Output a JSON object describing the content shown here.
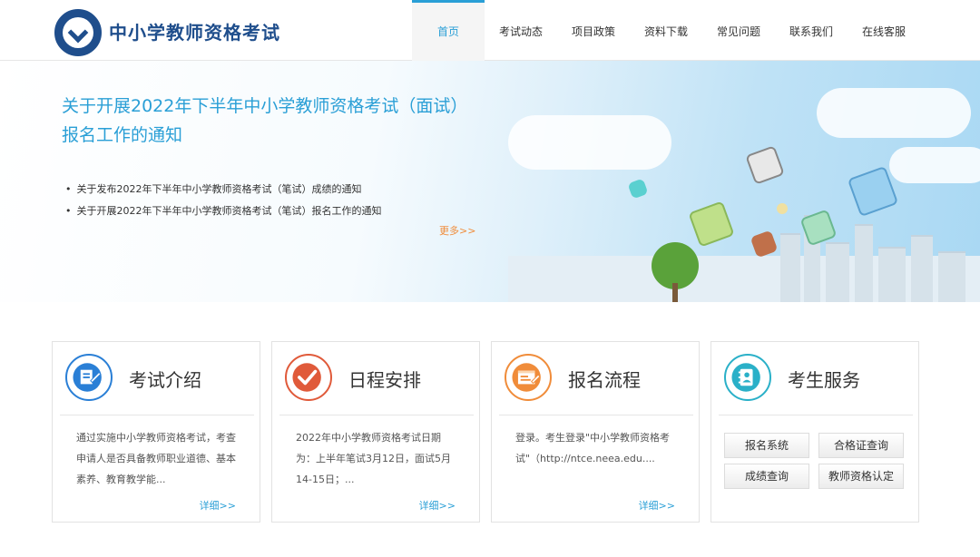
{
  "header": {
    "site_title": "中小学教师资格考试",
    "logo_icon": "book-logo-icon",
    "nav": [
      "首页",
      "考试动态",
      "项目政策",
      "资料下载",
      "常见问题",
      "联系我们",
      "在线客服"
    ],
    "active_nav": "首页"
  },
  "banner": {
    "title": "关于开展2022年下半年中小学教师资格考试（面试）报名工作的通知",
    "list": [
      "关于发布2022年下半年中小学教师资格考试（笔试）成绩的通知",
      "关于开展2022年下半年中小学教师资格考试（笔试）报名工作的通知"
    ],
    "more": "更多>>"
  },
  "cards": [
    {
      "title": "考试介绍",
      "icon": "document-edit-icon",
      "color": "#2a7fd6",
      "desc": "通过实施中小学教师资格考试，考查申请人是否具备教师职业道德、基本素养、教育教学能...",
      "link": "详细>>"
    },
    {
      "title": "日程安排",
      "icon": "checkmark-icon",
      "color": "#e05a3a",
      "desc": "2022年中小学教师资格考试日期为：上半年笔试3月12日，面试5月14-15日；...",
      "link": "详细>>"
    },
    {
      "title": "报名流程",
      "icon": "registration-form-icon",
      "color": "#f08c3a",
      "desc": "登录。考生登录\"中小学教师资格考试\"（http://ntce.neea.edu....",
      "link": "详细>>"
    },
    {
      "title": "考生服务",
      "icon": "contacts-book-icon",
      "color": "#2ab0c8",
      "buttons": [
        "报名系统",
        "合格证查询",
        "成绩查询",
        "教师资格认定"
      ]
    }
  ],
  "colors": {
    "accent": "#2a9fd6",
    "brand": "#1f4e8c",
    "more": "#f08c3a"
  }
}
